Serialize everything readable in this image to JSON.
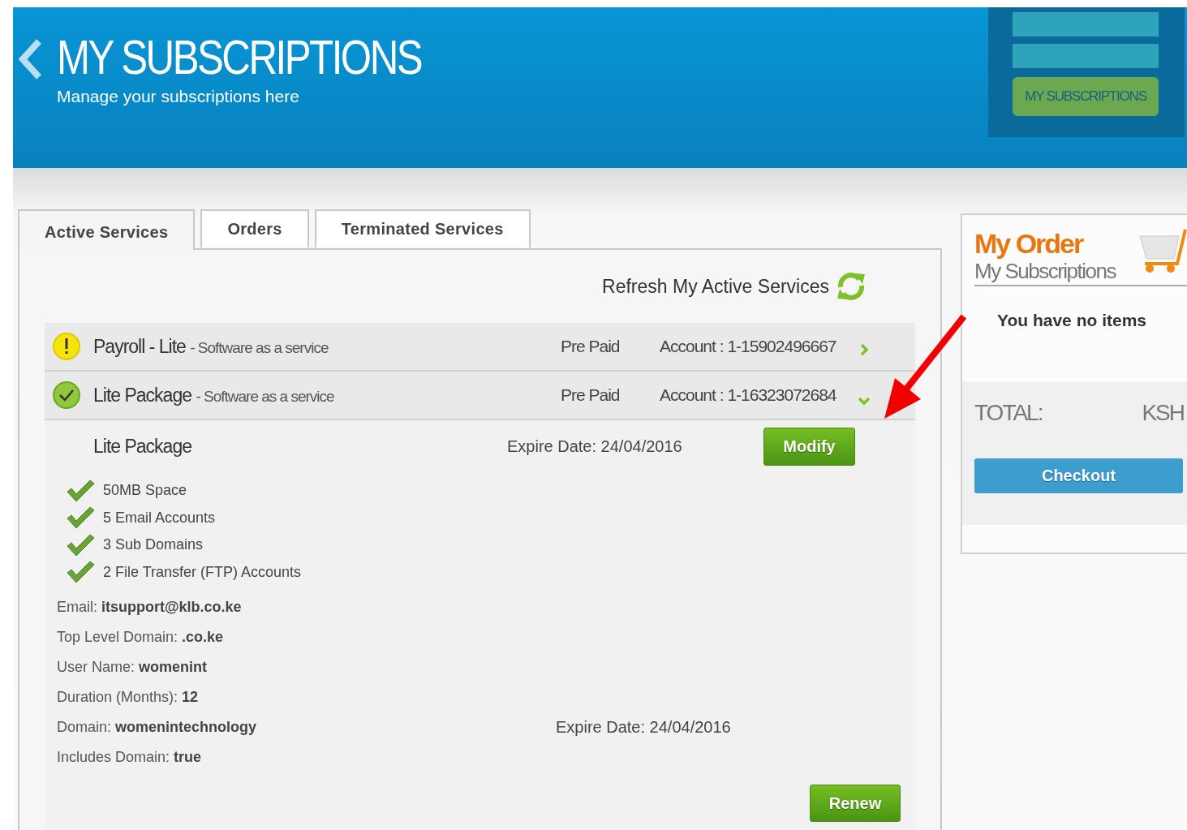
{
  "header": {
    "title": "MY SUBSCRIPTIONS",
    "subtitle": "Manage your subscriptions here",
    "ribbon_button": "MY SUBSCRIPTIONS"
  },
  "tabs": [
    {
      "label": "Active Services",
      "selected": true
    },
    {
      "label": "Orders",
      "selected": false
    },
    {
      "label": "Terminated Services",
      "selected": false
    }
  ],
  "refresh_label": "Refresh My Active Services",
  "services": [
    {
      "kind": "warning",
      "name": "Payroll - Lite",
      "description": "- Software as a service",
      "payment": "Pre Paid",
      "account": "Account : 1-15902496667",
      "expanded": false
    },
    {
      "kind": "ok",
      "name": "Lite Package",
      "description": "- Software as a service",
      "payment": "Pre Paid",
      "account": "Account : 1-16323072684",
      "expanded": true
    }
  ],
  "details": {
    "name": "Lite Package",
    "expire": "Expire Date:  24/04/2016",
    "modify_button": "Modify",
    "features": [
      "50MB Space",
      "5 Email Accounts",
      "3 Sub Domains",
      "2 File Transfer (FTP) Accounts"
    ],
    "fields": [
      {
        "text": "Email: **itsupport@klb.co.ke**"
      },
      {
        "text": "Top Level Domain: **.co.ke**"
      },
      {
        "text": "User Name: **womenint**"
      },
      {
        "text": "Duration (Months): **12**"
      },
      {
        "text": "Domain: **womenintechnology**",
        "aside": "Expire Date:  24/04/2016"
      },
      {
        "text": "Includes Domain: **true**"
      }
    ],
    "renew_button": "Renew"
  },
  "order": {
    "title": "My Order",
    "subtitle": "My Subscriptions",
    "empty": "You have no items",
    "total_label": "TOTAL:",
    "total_value": "KSH",
    "checkout_button": "Checkout"
  }
}
